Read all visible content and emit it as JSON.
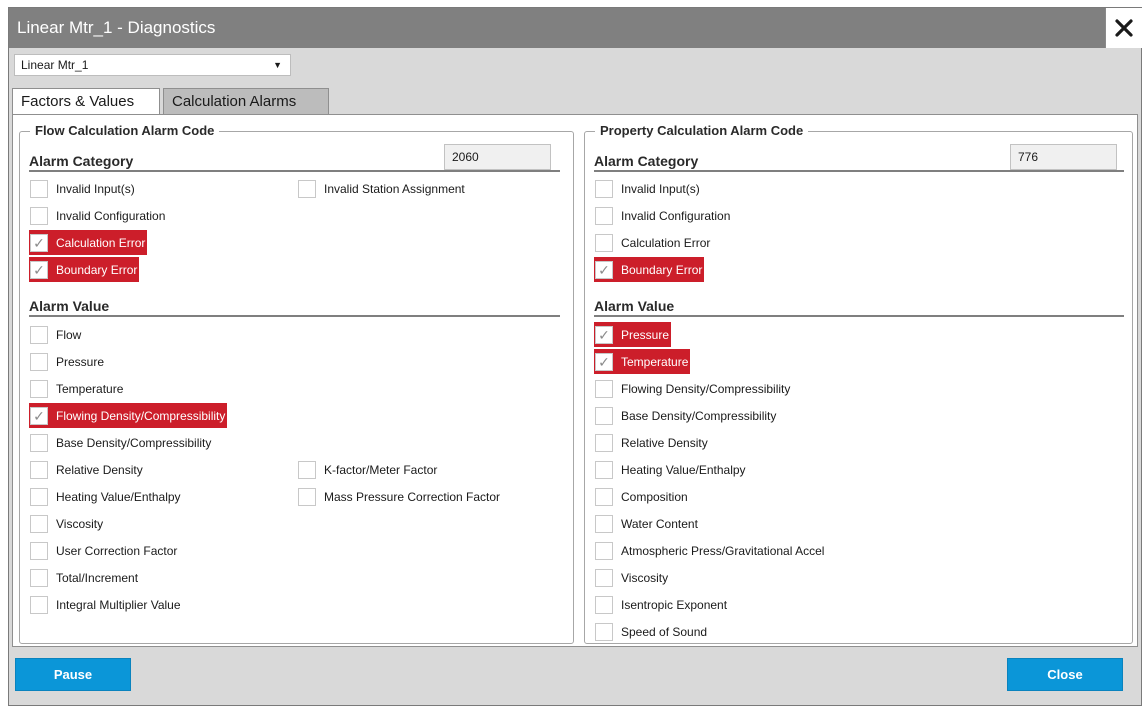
{
  "window": {
    "title": "Linear Mtr_1 - Diagnostics"
  },
  "meter_select": {
    "value": "Linear Mtr_1"
  },
  "tabs": [
    {
      "label": "Factors & Values",
      "active": false
    },
    {
      "label": "Calculation Alarms",
      "active": true
    }
  ],
  "flow": {
    "legend": "Flow Calculation Alarm Code",
    "code": "2060",
    "category_heading": "Alarm Category",
    "value_heading": "Alarm Value",
    "categories": [
      {
        "label": "Invalid Input(s)",
        "checked": false
      },
      {
        "label": "Invalid Station Assignment",
        "checked": false
      },
      {
        "label": "Invalid Configuration",
        "checked": false
      },
      {
        "label": "Calculation Error",
        "checked": true
      },
      {
        "label": "Boundary Error",
        "checked": true
      }
    ],
    "values": [
      {
        "label": "Flow",
        "checked": false
      },
      {
        "label": "Pressure",
        "checked": false
      },
      {
        "label": "Temperature",
        "checked": false
      },
      {
        "label": "Flowing Density/Compressibility",
        "checked": true
      },
      {
        "label": "Base Density/Compressibility",
        "checked": false
      },
      {
        "label": "Relative Density",
        "checked": false
      },
      {
        "label": "K-factor/Meter Factor",
        "checked": false
      },
      {
        "label": "Heating Value/Enthalpy",
        "checked": false
      },
      {
        "label": "Mass Pressure Correction Factor",
        "checked": false
      },
      {
        "label": "Viscosity",
        "checked": false
      },
      {
        "label": "User Correction Factor",
        "checked": false
      },
      {
        "label": "Total/Increment",
        "checked": false
      },
      {
        "label": "Integral Multiplier Value",
        "checked": false
      }
    ]
  },
  "property": {
    "legend": "Property Calculation Alarm Code",
    "code": "776",
    "category_heading": "Alarm Category",
    "value_heading": "Alarm Value",
    "categories": [
      {
        "label": "Invalid Input(s)",
        "checked": false
      },
      {
        "label": "Invalid Configuration",
        "checked": false
      },
      {
        "label": "Calculation Error",
        "checked": false
      },
      {
        "label": "Boundary Error",
        "checked": true
      }
    ],
    "values": [
      {
        "label": "Pressure",
        "checked": true
      },
      {
        "label": "Temperature",
        "checked": true
      },
      {
        "label": "Flowing Density/Compressibility",
        "checked": false
      },
      {
        "label": "Base Density/Compressibility",
        "checked": false
      },
      {
        "label": "Relative Density",
        "checked": false
      },
      {
        "label": "Heating Value/Enthalpy",
        "checked": false
      },
      {
        "label": "Composition",
        "checked": false
      },
      {
        "label": "Water Content",
        "checked": false
      },
      {
        "label": "Atmospheric Press/Gravitational Accel",
        "checked": false
      },
      {
        "label": "Viscosity",
        "checked": false
      },
      {
        "label": "Isentropic Exponent",
        "checked": false
      },
      {
        "label": "Speed of Sound",
        "checked": false
      }
    ]
  },
  "buttons": {
    "pause": "Pause",
    "close": "Close"
  },
  "icons": {
    "close": "close-icon",
    "dropdown": "chevron-down-icon",
    "check": "checkmark-icon"
  },
  "colors": {
    "alarm": "#cc1e2a",
    "button": "#0b96d8",
    "titlebar": "#808080"
  }
}
